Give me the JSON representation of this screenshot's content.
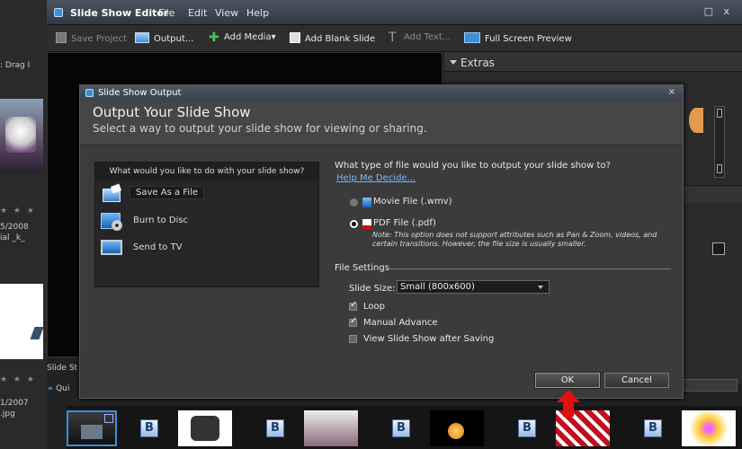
{
  "app": {
    "title": "Slide Show Editor",
    "menu": [
      "File",
      "Edit",
      "View",
      "Help"
    ],
    "window_controls": "□ x"
  },
  "toolbar": {
    "save_project": "Save Project",
    "output": "Output...",
    "add_media": "Add Media▾",
    "add_blank_slide": "Add Blank Slide",
    "add_text": "Add Text...",
    "full_screen_preview": "Full Screen Preview"
  },
  "left_strip": {
    "drag_text": ": Drag I",
    "date1": "5/2008",
    "name1": "ial _k_",
    "date2": "1/2007",
    "ext2": ".jpg"
  },
  "extras": {
    "header": "Extras"
  },
  "strip_labels": {
    "slide": "Slide St",
    "quick": "Qui"
  },
  "dialog": {
    "title": "Slide Show Output",
    "close": "×",
    "heading": "Output Your Slide Show",
    "subheading": "Select a way to output your slide show for viewing or sharing.",
    "question_left": "What would you like to do with your slide show?",
    "choices": [
      {
        "label": "Save As a File",
        "icon": "save-file-icon"
      },
      {
        "label": "Burn to Disc",
        "icon": "disc-icon"
      },
      {
        "label": "Send to TV",
        "icon": "tv-icon"
      }
    ],
    "question_right": "What type of file would you like to output your slide show to?",
    "help_link": "Help Me Decide...",
    "file_types": [
      {
        "label": "Movie File (.wmv)",
        "selected": false
      },
      {
        "label": "PDF File (.pdf)",
        "selected": true
      }
    ],
    "pdf_note": "Note: This option does not support attributes such as Pan & Zoom, videos, and certain transitions. However, the file size is usually smaller.",
    "file_settings_label": "File Settings",
    "slide_size_label": "Slide Size:",
    "slide_size_value": "Small (800x600)",
    "options": [
      {
        "label": "Loop",
        "checked": true
      },
      {
        "label": "Manual Advance",
        "checked": true
      },
      {
        "label": "View Slide Show after Saving",
        "checked": false
      }
    ],
    "ok": "OK",
    "cancel": "Cancel"
  },
  "colors": {
    "accent": "#3a8fd8",
    "link": "#7ab6ff",
    "arrow": "#e01010"
  }
}
